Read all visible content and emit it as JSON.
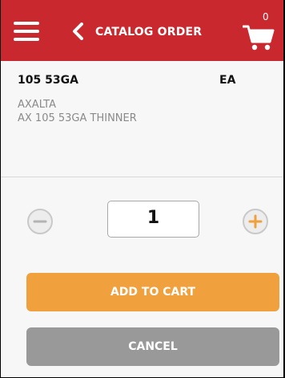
{
  "header": {
    "title": "CATALOG ORDER",
    "menu_icon": "hamburger-menu-icon",
    "back_icon": "chevron-left-icon",
    "cart_icon": "shopping-cart-icon",
    "cart_count": "0",
    "background_color": "#c8282e"
  },
  "product": {
    "part_number": "105 53GA",
    "unit": "EA",
    "brand": "AXALTA",
    "description": "AX 105 53GA THINNER"
  },
  "quantity": {
    "value": "1",
    "decrement_icon": "minus-circle-icon",
    "increment_icon": "plus-circle-icon",
    "increment_color": "#f0a03c"
  },
  "actions": {
    "add_to_cart_label": "ADD TO CART",
    "cancel_label": "CANCEL",
    "add_color": "#f0a03c",
    "cancel_color": "#999999"
  }
}
